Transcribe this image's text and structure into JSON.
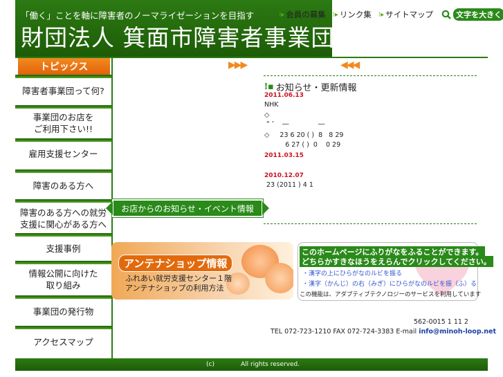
{
  "header": {
    "tagline": "「働く」ことを軸に障害者のノーマライゼーションを目指す",
    "org_title": "財団法人 箕面市障害者事業団",
    "links": [
      "会員の募集",
      "リンク集",
      "サイトマップ"
    ],
    "big_text_label": "文字を大きく"
  },
  "sidebar": {
    "topics_label": "トピックス",
    "items": [
      "障害者事業団って何?",
      "事業団のお店を\nご利用下さい!!",
      "雇用支援センター",
      "障害のある方へ",
      "障害のある方への就労\n支援に関心がある方へ",
      "支援事例",
      "情報公開に向けた\n取り組み",
      "事業団の発行物",
      "アクセスマップ"
    ]
  },
  "main": {
    "arrows_right": "▶▶▶",
    "arrows_left": "◀◀◀",
    "event_banner": "お店からのお知らせ・イベント情報",
    "news": {
      "title": "お知らせ・更新情報",
      "entries": [
        {
          "date": "2011.06.13",
          "lines": [
            "NHK",
            "◇",
            " “ ’    ―              ―",
            "◇     23 6 20 ( )  8   8 29",
            "          6 27 ( )  0    0 29"
          ]
        },
        {
          "date": "2011.03.15",
          "lines": []
        },
        {
          "date": "2010.12.07",
          "lines": [
            " 23 (2011 ) 4 1"
          ]
        }
      ]
    },
    "antenna": {
      "title": "アンテナショップ情報",
      "line1": "ふれあい就労支援センター１階",
      "line2": "アンテナショップの利用方法"
    },
    "ruby": {
      "heading1": "このホームページにふりがなをふることができます。",
      "heading2": "どちらかすきなほうをえらんでクリックしてください。",
      "link1": "・漢字の上にひらがなのルビを振る",
      "link2": "・漢字（かんじ）の右（みぎ）にひらがなのルビを振（ふ）る",
      "note": "この機能は、アダプティブテクノロジーのサービスを利用しています"
    }
  },
  "address": {
    "postal": "562-0015      1  11 2",
    "contact": "TEL 072-723-1210 FAX 072-724-3383 E-mail ",
    "email": "info@minoh-loop.net"
  },
  "footer": {
    "copyright": "(c)",
    "rights": "All rights reserved."
  },
  "colors": {
    "brand_green": "#2c7a13",
    "accent_orange": "#f28a1e",
    "date_red": "#cc1122"
  }
}
